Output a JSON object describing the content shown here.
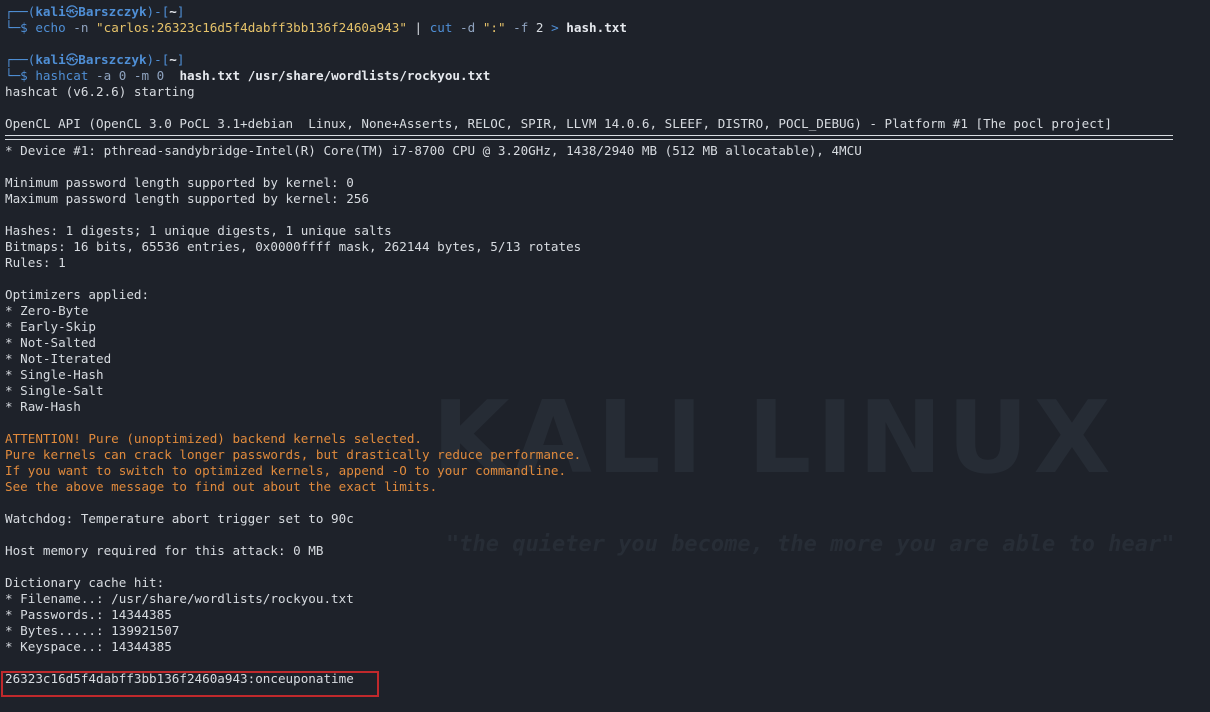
{
  "background": {
    "watermark": "KALI LINUX",
    "quote": "\"the quieter you become, the more you are able to hear\""
  },
  "prompt": {
    "user": "kali",
    "skull": "㉿",
    "host": "Barszczyk",
    "dir": "~",
    "top_left": "┌──(",
    "top_mid": ")-[",
    "top_right": "]",
    "bottom": "└─$"
  },
  "commands": [
    {
      "cmd": "echo",
      "flag1": "-n",
      "string": "\"carlos:26323c16d5f4dabff3bb136f2460a943\"",
      "pipe": "|",
      "cmd2": "cut",
      "flag2": "-d",
      "delim": "\":\"",
      "flag3": "-f",
      "field": "2",
      "redir": ">",
      "outfile": "hash.txt"
    },
    {
      "cmd": "hashcat",
      "args": "-a 0 -m 0",
      "file1": "hash.txt",
      "file2": "/usr/share/wordlists/rockyou.txt"
    }
  ],
  "output": {
    "starting": "hashcat (v6.2.6) starting",
    "opencl": "OpenCL API (OpenCL 3.0 PoCL 3.1+debian  Linux, None+Asserts, RELOC, SPIR, LLVM 14.0.6, SLEEF, DISTRO, POCL_DEBUG) - Platform #1 [The pocl project]",
    "device": "* Device #1: pthread-sandybridge-Intel(R) Core(TM) i7-8700 CPU @ 3.20GHz, 1438/2940 MB (512 MB allocatable), 4MCU",
    "min_pw": "Minimum password length supported by kernel: 0",
    "max_pw": "Maximum password length supported by kernel: 256",
    "hashes": "Hashes: 1 digests; 1 unique digests, 1 unique salts",
    "bitmaps": "Bitmaps: 16 bits, 65536 entries, 0x0000ffff mask, 262144 bytes, 5/13 rotates",
    "rules": "Rules: 1",
    "optimizers_title": "Optimizers applied:",
    "optimizers": [
      "* Zero-Byte",
      "* Early-Skip",
      "* Not-Salted",
      "* Not-Iterated",
      "* Single-Hash",
      "* Single-Salt",
      "* Raw-Hash"
    ],
    "attention": [
      "ATTENTION! Pure (unoptimized) backend kernels selected.",
      "Pure kernels can crack longer passwords, but drastically reduce performance.",
      "If you want to switch to optimized kernels, append -O to your commandline.",
      "See the above message to find out about the exact limits."
    ],
    "watchdog": "Watchdog: Temperature abort trigger set to 90c",
    "host_memory": "Host memory required for this attack: 0 MB",
    "dict_title": "Dictionary cache hit:",
    "dict": [
      "* Filename..: /usr/share/wordlists/rockyou.txt",
      "* Passwords.: 14344385",
      "* Bytes.....: 139921507",
      "* Keyspace..: 14344385"
    ],
    "cracked": "26323c16d5f4dabff3bb136f2460a943:onceuponatime"
  },
  "colors": {
    "background": "#1e222a",
    "text": "#d7dbe0",
    "prompt_blue": "#4f8fd6",
    "string_yellow": "#e6c36a",
    "warning_orange": "#e08a3c",
    "highlight_red": "#c0292c"
  }
}
